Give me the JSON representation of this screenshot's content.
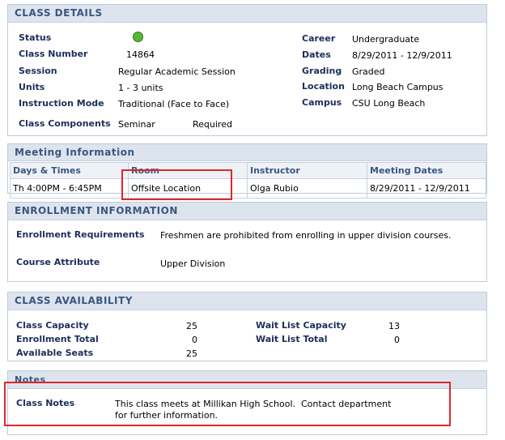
{
  "class_details": {
    "header": "CLASS DETAILS",
    "status_label": "Status",
    "status_icon": "open-status-icon",
    "class_number_label": "Class Number",
    "class_number": "14864",
    "session_label": "Session",
    "session": "Regular Academic Session",
    "units_label": "Units",
    "units": "1 - 3 units",
    "instruction_mode_label": "Instruction Mode",
    "instruction_mode": "Traditional (Face to Face)",
    "class_components_label": "Class Components",
    "component": "Seminar",
    "component_required": "Required",
    "career_label": "Career",
    "career": "Undergraduate",
    "dates_label": "Dates",
    "dates": "8/29/2011 - 12/9/2011",
    "grading_label": "Grading",
    "grading": "Graded",
    "location_label": "Location",
    "location": "Long Beach Campus",
    "campus_label": "Campus",
    "campus": "CSU Long Beach"
  },
  "meeting_information": {
    "header": "Meeting Information",
    "columns": [
      "Days & Times",
      "Room",
      "Instructor",
      "Meeting Dates"
    ],
    "rows": [
      [
        "Th 4:00PM - 6:45PM",
        "Offsite Location",
        "Olga Rubio",
        "8/29/2011 - 12/9/2011"
      ]
    ]
  },
  "enrollment_information": {
    "header": "ENROLLMENT INFORMATION",
    "requirements_label": "Enrollment Requirements",
    "requirements": "Freshmen are prohibited from enrolling in upper division courses.",
    "attribute_label": "Course Attribute",
    "attribute": "Upper Division"
  },
  "class_availability": {
    "header": "CLASS AVAILABILITY",
    "class_capacity_label": "Class Capacity",
    "class_capacity": "25",
    "enrollment_total_label": "Enrollment Total",
    "enrollment_total": "0",
    "available_seats_label": "Available Seats",
    "available_seats": "25",
    "wait_list_capacity_label": "Wait List Capacity",
    "wait_list_capacity": "13",
    "wait_list_total_label": "Wait List Total",
    "wait_list_total": "0"
  },
  "notes": {
    "header": "Notes",
    "class_notes_label": "Class Notes",
    "class_notes_line1": "This class meets at Millikan High School.  Contact department",
    "class_notes_line2": "for further information."
  },
  "colors": {
    "header_bg": "#dde4ee",
    "header_text": "#3a5780",
    "status_open": "#5ab534",
    "highlight": "#e0262a"
  }
}
